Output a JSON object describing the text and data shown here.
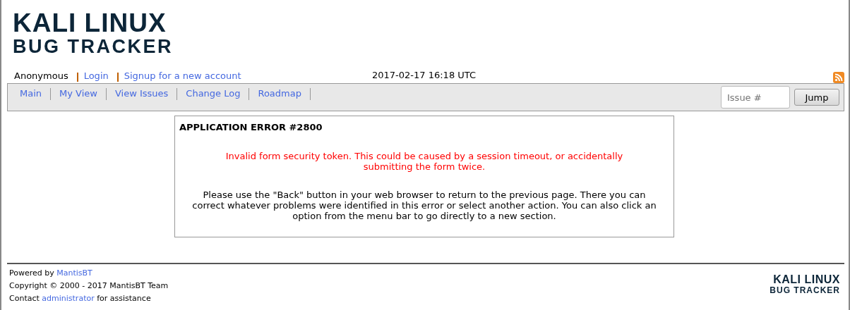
{
  "logo": {
    "line_1": "KALI LINUX",
    "line_2": "BUG TRACKER"
  },
  "login_bar": {
    "user": "Anonymous",
    "links": [
      "Login",
      "Signup for a new account"
    ],
    "datetime": "2017-02-17 16:18 UTC"
  },
  "menu": {
    "items": [
      "Main",
      "My View",
      "View Issues",
      "Change Log",
      "Roadmap"
    ],
    "issue_field": {
      "placeholder": "Issue #"
    },
    "jump_button": "Jump"
  },
  "error": {
    "title": "APPLICATION ERROR #2800",
    "message": "Invalid form security token. This could be caused by a session timeout, or accidentally submitting the form twice.",
    "help": "Please use the \"Back\" button in your web browser to return to the previous page. There you can correct whatever problems were identified in this error or select another action. You can also click an option from the menu bar to go directly to a new section."
  },
  "footer": {
    "powered": {
      "before": "Powered by ",
      "link": "MantisBT"
    },
    "copyright": "Copyright © 2000 - 2017 MantisBT Team",
    "contact": {
      "before": "Contact ",
      "link": "administrator",
      "after": " for assistance"
    },
    "logo": {
      "line_1": "KALI LINUX",
      "line_2": "BUG TRACKER"
    }
  }
}
